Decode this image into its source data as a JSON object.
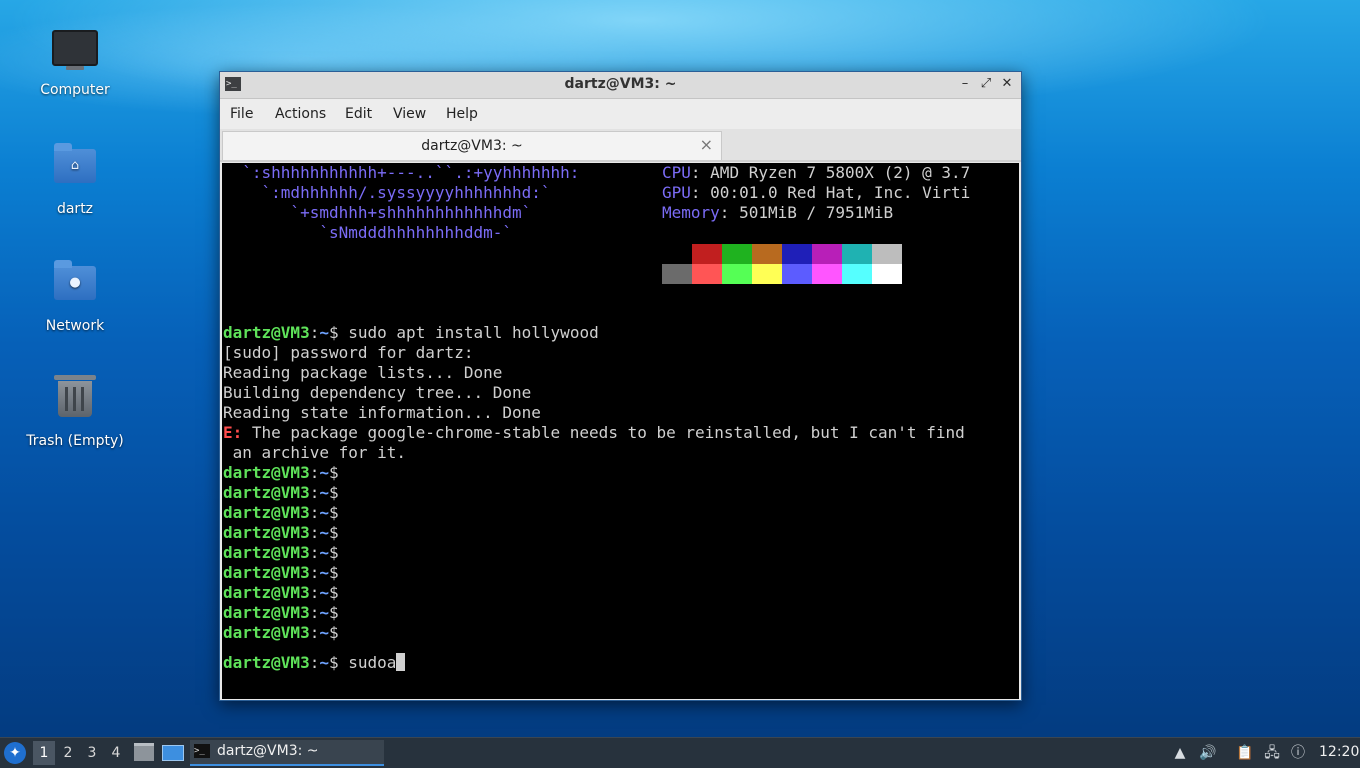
{
  "desktop": {
    "icons": [
      {
        "label": "Computer",
        "icon": "computer-icon"
      },
      {
        "label": "dartz",
        "icon": "home-folder-icon"
      },
      {
        "label": "Network",
        "icon": "network-folder-icon"
      },
      {
        "label": "Trash (Empty)",
        "icon": "trash-icon"
      }
    ]
  },
  "window": {
    "title": "dartz@VM3: ~",
    "menu": [
      "File",
      "Actions",
      "Edit",
      "View",
      "Help"
    ],
    "tab_label": "dartz@VM3: ~",
    "tab_close": "×",
    "controls": {
      "minimize": "–",
      "maximize": "⤢",
      "close": "✕"
    }
  },
  "terminal": {
    "logo_lines": [
      "  `:shhhhhhhhhhh+---..``.:+yyhhhhhhh:",
      "    `:mdhhhhhh/.syssyyyyhhhhhhhd:`",
      "       `+smdhhh+shhhhhhhhhhhhdm`",
      "          `sNmdddhhhhhhhhddm-`"
    ],
    "info": [
      {
        "key": "CPU",
        "value": ": AMD Ryzen 7 5800X (2) @ 3.7"
      },
      {
        "key": "GPU",
        "value": ": 00:01.0 Red Hat, Inc. Virti"
      },
      {
        "key": "Memory",
        "value": ": 501MiB / 7951MiB"
      }
    ],
    "palette": {
      "row1": [
        "#000000",
        "#c11f1f",
        "#1fb21f",
        "#b86a1f",
        "#1f1fb8",
        "#b81fb8",
        "#1fb2b2",
        "#bdbdbd"
      ],
      "row2": [
        "#6b6b6b",
        "#ff5555",
        "#55ff55",
        "#ffff55",
        "#5c5cff",
        "#ff55ff",
        "#55ffff",
        "#ffffff"
      ]
    },
    "prompt_user": "dartz@VM3",
    "prompt_sep": ":",
    "prompt_path": "~",
    "prompt_dollar": "$",
    "command_1": " sudo apt install hollywood",
    "output": [
      "[sudo] password for dartz:",
      "Reading package lists... Done",
      "Building dependency tree... Done",
      "Reading state information... Done"
    ],
    "error_tag": "E:",
    "error_text": " The package google-chrome-stable needs to be reinstalled, but I can't find",
    "error_cont": " an archive for it.",
    "empty_prompts": 9,
    "current_input": " sudoa"
  },
  "taskbar": {
    "workspaces": [
      "1",
      "2",
      "3",
      "4"
    ],
    "active_workspace": "1",
    "task_label": "dartz@VM3: ~",
    "clock": "12:20"
  }
}
